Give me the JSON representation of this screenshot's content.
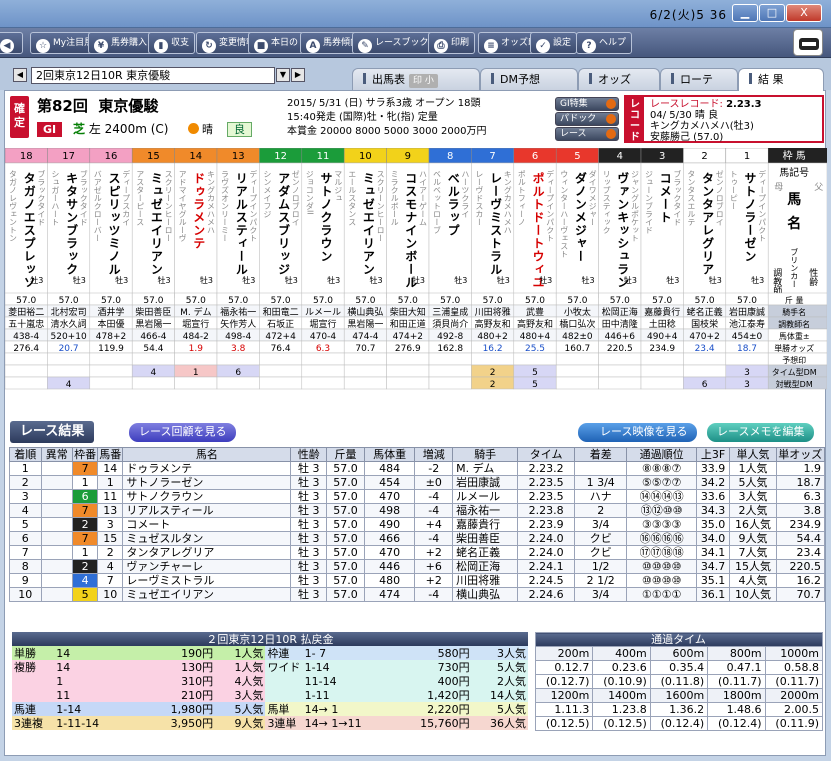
{
  "window": {
    "datetime": "6/2(火)5 36",
    "min": "▁",
    "max": "□",
    "close": "X"
  },
  "toolbar": [
    {
      "name": "back",
      "icon": "◀",
      "label": ""
    },
    {
      "name": "my-chuumoku",
      "icon": "☆",
      "label": "My注目馬"
    },
    {
      "name": "baken-kounyuu",
      "icon": "¥",
      "label": "馬券購入"
    },
    {
      "name": "shuushi",
      "icon": "▮",
      "label": "収支"
    },
    {
      "name": "henkou-jouhou",
      "icon": "↻",
      "label": "変更情報"
    },
    {
      "name": "honjitsu",
      "icon": "■",
      "label": "本日の"
    },
    {
      "name": "baken-keikou",
      "icon": "A",
      "label": "馬券傾向"
    },
    {
      "name": "race-bookmark",
      "icon": "✎",
      "label": "レースブックマーク"
    },
    {
      "name": "print",
      "icon": "⎙",
      "label": "印刷"
    },
    {
      "name": "odds-print",
      "icon": "≡",
      "label": "オッズ印刷"
    },
    {
      "name": "settings",
      "icon": "✓",
      "label": "設定"
    },
    {
      "name": "help",
      "icon": "?",
      "label": "ヘルプ"
    }
  ],
  "nav": {
    "race_select": "2回東京12日10R 東京優駿",
    "tabs": [
      {
        "label": "出馬表",
        "sub": "印 小"
      },
      {
        "label": "DM予想",
        "sub": ""
      },
      {
        "label": "オッズ",
        "sub": ""
      },
      {
        "label": "ローテ",
        "sub": ""
      },
      {
        "label": "結 果",
        "sub": ""
      }
    ]
  },
  "race": {
    "kakutei": "確定",
    "number": "第82回",
    "name": "東京優駿",
    "grade": "GI",
    "course_turf": "芝",
    "course_rest": "左 2400m (C)",
    "weather": "晴",
    "going": "良",
    "line1": "2015/ 5/31 (日) サラ系3歳 オープン 18頭",
    "line2": "15:40発走 (国際)牡・牝(指) 定量",
    "line3": "本賞金 20000 8000 5000 3000 2000万円",
    "btn_g1": "GI特集",
    "btn_paddock": "パドック",
    "btn_race": "レース",
    "record_label": "レコード",
    "record_title": "レースレコード:",
    "record_time": "2.23.3",
    "record_date": "04/ 5/30 晴 良",
    "record_horse": "キングカメハメハ(牡3)",
    "record_jockey": "安藤勝己 (57.0)"
  },
  "frame_header": {
    "waku_label": "枠 馬",
    "col_label": "馬記号",
    "mother": "母",
    "father": "父",
    "uma": "馬",
    "mei": "名",
    "bloodline": "ブリンカー",
    "kinryou_lbl": "斤 量",
    "jockey_lbl": "騎手名",
    "trainer_lbl": "調教師名",
    "weight_lbl": "馬体重±",
    "odds_lbl": "単勝オッズ",
    "yosou_lbl": "予想印",
    "timedm_lbl": "タイム型DM",
    "taisendm_lbl": "対戦型DM",
    "seirei": "性齢",
    "shukyu": "調教師"
  },
  "horses": [
    {
      "no": "18",
      "waku": "8",
      "name": "タガノエスプレッソ",
      "sire": "ブラックタイド",
      "dam": "タガノレヴェントン",
      "sa": "牡3",
      "kin": "57.0",
      "jockey": "菱田裕二",
      "trainer": "五十嵐忠",
      "bw": "438-4",
      "odds": "276.4",
      "tdm": "",
      "vdm": ""
    },
    {
      "no": "17",
      "waku": "8",
      "name": "キタサンブラック",
      "sire": "ブラックタイド",
      "dam": "シュガーハート",
      "sa": "牡3",
      "kin": "57.0",
      "jockey": "北村宏司",
      "trainer": "清水久詞",
      "bw": "520+10",
      "odds": "20.7",
      "tdm": "",
      "vdm": "4"
    },
    {
      "no": "16",
      "waku": "8",
      "name": "スピリッツミノル",
      "sire": "ディープスカイ",
      "dam": "バアゼルクローバー",
      "sa": "牡3",
      "kin": "57.0",
      "jockey": "酒井学",
      "trainer": "本田優",
      "bw": "478+2",
      "odds": "119.9",
      "tdm": "",
      "vdm": ""
    },
    {
      "no": "15",
      "waku": "7",
      "name": "ミュゼエイリアン",
      "sire": "スクリーンヒーロー",
      "dam": "アスターピース",
      "sa": "牡3",
      "kin": "57.0",
      "jockey": "柴田善臣",
      "trainer": "黒岩陽一",
      "bw": "466-4",
      "odds": "54.4",
      "tdm": "4",
      "vdm": ""
    },
    {
      "no": "14",
      "waku": "7",
      "name": "ドゥラメンテ",
      "sire": "キングカメハメハ",
      "dam": "アドマイヤグルーヴ",
      "sa": "牡3",
      "kin": "57.0",
      "jockey": "M. デム",
      "trainer": "堀宣行",
      "bw": "484-2",
      "odds": "1.9",
      "tdm": "1",
      "vdm": ""
    },
    {
      "no": "13",
      "waku": "7",
      "name": "リアルスティール",
      "sire": "ディープインパクト",
      "dam": "ラヴズオンリーミー",
      "sa": "牡3",
      "kin": "57.0",
      "jockey": "福永祐一",
      "trainer": "矢作芳人",
      "bw": "498-4",
      "odds": "3.8",
      "tdm": "6",
      "vdm": ""
    },
    {
      "no": "12",
      "waku": "6",
      "name": "アダムスブリッジ",
      "sire": "ゼンノロブロイ",
      "dam": "シンメイフジ",
      "sa": "牡3",
      "kin": "57.0",
      "jockey": "和田竜二",
      "trainer": "石坂正",
      "bw": "472+4",
      "odds": "76.4",
      "tdm": "",
      "vdm": ""
    },
    {
      "no": "11",
      "waku": "6",
      "name": "サトノクラウン",
      "sire": "マルジュ",
      "dam": "ジョコンダII",
      "sa": "牡3",
      "kin": "57.0",
      "jockey": "ルメール",
      "trainer": "堀宣行",
      "bw": "470-4",
      "odds": "6.3",
      "tdm": "",
      "vdm": ""
    },
    {
      "no": "10",
      "waku": "5",
      "name": "ミュゼエイリアン",
      "sire": "スクリーンヒーロー",
      "dam": "エールスタンス",
      "sa": "牡3",
      "kin": "57.0",
      "jockey": "横山典弘",
      "trainer": "黒岩陽一",
      "bw": "474-4",
      "odds": "70.7",
      "tdm": "",
      "vdm": ""
    },
    {
      "no": "9",
      "waku": "5",
      "name": "コスモナインボール",
      "sire": "ハイアーゲーム",
      "dam": "ミラクルボール",
      "sa": "牡3",
      "kin": "57.0",
      "jockey": "柴田大知",
      "trainer": "和田正道",
      "bw": "474+2",
      "odds": "276.9",
      "tdm": "",
      "vdm": ""
    },
    {
      "no": "8",
      "waku": "4",
      "name": "ベルラップ",
      "sire": "ハーツクライ",
      "dam": "ベルベットローブ",
      "sa": "牡3",
      "kin": "57.0",
      "jockey": "三浦皇成",
      "trainer": "須貝尚介",
      "bw": "492-8",
      "odds": "162.8",
      "tdm": "",
      "vdm": ""
    },
    {
      "no": "7",
      "waku": "4",
      "name": "レーヴミストラル",
      "sire": "キングカメハメハ",
      "dam": "レーヴドスカー",
      "sa": "牡3",
      "kin": "57.0",
      "jockey": "川田将雅",
      "trainer": "高野友和",
      "bw": "480+2",
      "odds": "16.2",
      "tdm": "2",
      "vdm": "2"
    },
    {
      "no": "6",
      "waku": "3",
      "name": "ポルトドートウィユ",
      "sire": "ディープインパクト",
      "dam": "ポルトフィーノ",
      "sa": "牡3",
      "kin": "57.0",
      "jockey": "武豊",
      "trainer": "高野友和",
      "bw": "480+4",
      "odds": "25.5",
      "tdm": "5",
      "vdm": "5"
    },
    {
      "no": "5",
      "waku": "3",
      "name": "ダノンメジャー",
      "sire": "ダイワメジャー",
      "dam": "ウィンターハーヴェスト",
      "sa": "牡3",
      "kin": "57.0",
      "jockey": "小牧太",
      "trainer": "橋口弘次",
      "bw": "482±0",
      "odds": "160.7",
      "tdm": "",
      "vdm": ""
    },
    {
      "no": "4",
      "waku": "2",
      "name": "ヴァンキッシュラン",
      "sire": "ジャングルポケット",
      "dam": "リップスティック",
      "sa": "牡3",
      "kin": "57.0",
      "jockey": "松岡正海",
      "trainer": "田中清隆",
      "bw": "446+6",
      "odds": "220.5",
      "tdm": "",
      "vdm": ""
    },
    {
      "no": "3",
      "waku": "2",
      "name": "コメート",
      "sire": "ブラックタイド",
      "dam": "ジューンブライド",
      "sa": "牡3",
      "kin": "57.0",
      "jockey": "嘉藤貴行",
      "trainer": "土田稔",
      "bw": "490+4",
      "odds": "234.9",
      "tdm": "",
      "vdm": ""
    },
    {
      "no": "2",
      "waku": "1",
      "name": "タンタアレグリア",
      "sire": "ゼンノロブロイ",
      "dam": "タンタスエルテ",
      "sa": "牡3",
      "kin": "57.0",
      "jockey": "蛯名正義",
      "trainer": "国枝栄",
      "bw": "470+2",
      "odds": "23.4",
      "tdm": "",
      "vdm": "6"
    },
    {
      "no": "1",
      "waku": "1",
      "name": "サトノラーゼン",
      "sire": "ディープインパクト",
      "dam": "トゥーピー",
      "sa": "牡3",
      "kin": "57.0",
      "jockey": "岩田康誠",
      "trainer": "池江泰寿",
      "bw": "454±0",
      "odds": "18.7",
      "tdm": "3",
      "vdm": "3"
    }
  ],
  "results_section": {
    "title": "レース結果",
    "btn_replay": "レース回顧を見る",
    "btn_video": "レース映像を見る",
    "btn_memo": "レースメモを編集",
    "headers": [
      "着順",
      "異常",
      "枠番",
      "馬番",
      "馬名",
      "性齢",
      "斤量",
      "馬体重",
      "増減",
      "騎手",
      "タイム",
      "着差",
      "通過順位",
      "上3F",
      "単人気",
      "単オッズ"
    ],
    "rows": [
      {
        "pos": "1",
        "ab": "",
        "w": "7",
        "no": "14",
        "name": "ドゥラメンテ",
        "sa": "牡 3",
        "kin": "57.0",
        "bw": "484",
        "diff": "-2",
        "jockey": "M. デム",
        "time": "2.23.2",
        "margin": "",
        "pass": "⑧⑧⑧⑦",
        "l3f": "33.9",
        "pop": "1人気",
        "odds": "1.9"
      },
      {
        "pos": "2",
        "ab": "",
        "w": "1",
        "no": "1",
        "name": "サトノラーゼン",
        "sa": "牡 3",
        "kin": "57.0",
        "bw": "454",
        "diff": "±0",
        "jockey": "岩田康誠",
        "time": "2.23.5",
        "margin": "1 3/4",
        "pop": "5人気",
        "pass": "⑤⑤⑦⑦",
        "l3f": "34.2",
        "odds": "18.7"
      },
      {
        "pos": "3",
        "ab": "",
        "w": "6",
        "no": "11",
        "name": "サトノクラウン",
        "sa": "牡 3",
        "kin": "57.0",
        "bw": "470",
        "diff": "-4",
        "jockey": "ルメール",
        "time": "2.23.5",
        "margin": "ハナ",
        "pass": "⑭⑭⑭⑬",
        "l3f": "33.6",
        "pop": "3人気",
        "odds": "6.3"
      },
      {
        "pos": "4",
        "ab": "",
        "w": "7",
        "no": "13",
        "name": "リアルスティール",
        "sa": "牡 3",
        "kin": "57.0",
        "bw": "498",
        "diff": "-4",
        "jockey": "福永祐一",
        "time": "2.23.8",
        "margin": "2",
        "pass": "⑬⑫⑩⑩",
        "l3f": "34.3",
        "pop": "2人気",
        "odds": "3.8"
      },
      {
        "pos": "5",
        "ab": "",
        "w": "2",
        "no": "3",
        "name": "コメート",
        "sa": "牡 3",
        "kin": "57.0",
        "bw": "490",
        "diff": "+4",
        "jockey": "嘉藤貴行",
        "time": "2.23.9",
        "margin": "3/4",
        "pass": "③③③③",
        "l3f": "35.0",
        "pop": "16人気",
        "odds": "234.9"
      },
      {
        "pos": "6",
        "ab": "",
        "w": "7",
        "no": "15",
        "name": "ミュゼスルタン",
        "sa": "牡 3",
        "kin": "57.0",
        "bw": "466",
        "diff": "-4",
        "jockey": "柴田善臣",
        "time": "2.24.0",
        "margin": "クビ",
        "pass": "⑯⑯⑯⑯",
        "l3f": "34.0",
        "pop": "9人気",
        "odds": "54.4"
      },
      {
        "pos": "7",
        "ab": "",
        "w": "1",
        "no": "2",
        "name": "タンタアレグリア",
        "sa": "牡 3",
        "kin": "57.0",
        "bw": "470",
        "diff": "+2",
        "jockey": "蛯名正義",
        "time": "2.24.0",
        "margin": "クビ",
        "pass": "⑰⑰⑱⑱",
        "l3f": "34.1",
        "pop": "7人気",
        "odds": "23.4"
      },
      {
        "pos": "8",
        "ab": "",
        "w": "2",
        "no": "4",
        "name": "ヴァンチャーレ",
        "sa": "牡 3",
        "kin": "57.0",
        "bw": "446",
        "diff": "+6",
        "jockey": "松岡正海",
        "time": "2.24.1",
        "margin": "1/2",
        "pass": "⑩⑩⑩⑩",
        "l3f": "34.7",
        "pop": "15人気",
        "odds": "220.5"
      },
      {
        "pos": "9",
        "ab": "",
        "w": "4",
        "no": "7",
        "name": "レーヴミストラル",
        "sa": "牡 3",
        "kin": "57.0",
        "bw": "480",
        "diff": "+2",
        "jockey": "川田将雅",
        "time": "2.24.5",
        "margin": "2 1/2",
        "pass": "⑩⑩⑩⑩",
        "l3f": "35.1",
        "pop": "4人気",
        "odds": "16.2"
      },
      {
        "pos": "10",
        "ab": "",
        "w": "5",
        "no": "10",
        "name": "ミュゼエイリアン",
        "sa": "牡 3",
        "kin": "57.0",
        "bw": "474",
        "diff": "-4",
        "jockey": "横山典弘",
        "time": "2.24.6",
        "margin": "3/4",
        "pass": "①①①①",
        "l3f": "36.1",
        "pop": "10人気",
        "odds": "70.7"
      }
    ]
  },
  "payout": {
    "title": "２回東京12日10R 払戻金",
    "left": [
      {
        "type": "単勝",
        "combo": "14",
        "amount": "190円",
        "pop": "1人気"
      },
      {
        "type": "複勝",
        "combo": "14",
        "amount": "130円",
        "pop": "1人気"
      },
      {
        "type": "",
        "combo": "1",
        "amount": "310円",
        "pop": "4人気"
      },
      {
        "type": "",
        "combo": "11",
        "amount": "210円",
        "pop": "3人気"
      },
      {
        "type": "馬連",
        "combo": "1-14",
        "amount": "1,980円",
        "pop": "5人気"
      },
      {
        "type": "3連複",
        "combo": "1-11-14",
        "amount": "3,950円",
        "pop": "9人気"
      }
    ],
    "right": [
      {
        "type": "枠連",
        "combo": "1- 7",
        "amount": "580円",
        "pop": "3人気"
      },
      {
        "type": "ワイド",
        "combo": "1-14",
        "amount": "730円",
        "pop": "5人気"
      },
      {
        "type": "",
        "combo": "11-14",
        "amount": "400円",
        "pop": "2人気"
      },
      {
        "type": "",
        "combo": "1-11",
        "amount": "1,420円",
        "pop": "14人気"
      },
      {
        "type": "馬単",
        "combo": "14→ 1",
        "amount": "2,220円",
        "pop": "5人気"
      },
      {
        "type": "3連単",
        "combo": "14→ 1→11",
        "amount": "15,760円",
        "pop": "36人気"
      }
    ]
  },
  "passing_time": {
    "title": "通過タイム",
    "rows": [
      {
        "h": [
          "200m",
          "400m",
          "600m",
          "800m",
          "1000m"
        ],
        "v": [
          "0.12.7",
          "0.23.6",
          "0.35.4",
          "0.47.1",
          "0.58.8"
        ],
        "s": [
          "(0.12.7)",
          "(0.10.9)",
          "(0.11.8)",
          "(0.11.7)",
          "(0.11.7)"
        ]
      },
      {
        "h": [
          "1200m",
          "1400m",
          "1600m",
          "1800m",
          "2000m"
        ],
        "v": [
          "1.11.3",
          "1.23.8",
          "1.36.2",
          "1.48.6",
          "2.00.5"
        ],
        "s": [
          "(0.12.5)",
          "(0.12.5)",
          "(0.12.4)",
          "(0.12.4)",
          "(0.11.9)"
        ]
      }
    ]
  },
  "colors": {
    "waku1": "#ffffff",
    "waku2": "#222222",
    "waku3": "#e8372c",
    "waku4": "#2f6fd6",
    "waku5": "#f2d21a",
    "waku6": "#1b9c3a",
    "waku7": "#f08a2a",
    "waku8": "#f3a0c3"
  }
}
